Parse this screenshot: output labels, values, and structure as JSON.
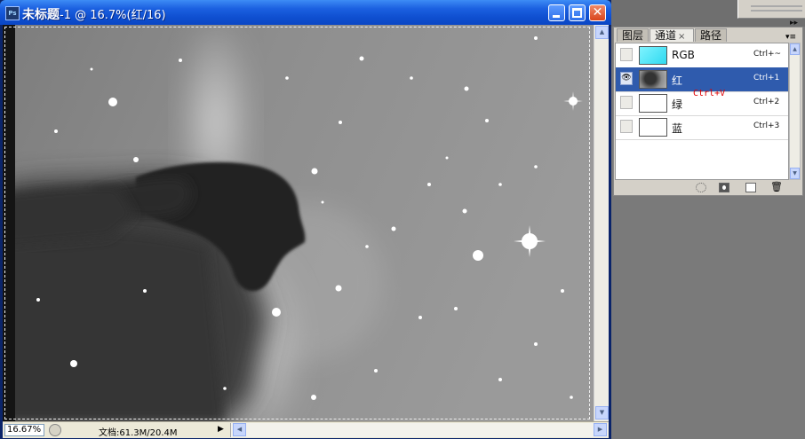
{
  "document": {
    "name": "未标题",
    "title_rest": "-1 @ 16.7%(红/16)",
    "app_icon": "Ps",
    "zoom": "16.67%",
    "doc_info": "文档:61.3M/20.4M"
  },
  "icons": {
    "minimize": "minimize-icon",
    "maximize": "maximize-icon",
    "close": "close-icon",
    "visibility": "eye-icon",
    "trash": "trash-icon"
  },
  "glyphs": {
    "close": "✕",
    "eye": "👁",
    "up": "▲",
    "down": "▼",
    "left": "◀",
    "right": "▶",
    "menu": "▾≡",
    "collapse": "▸▸",
    "trash": "🗑",
    "tab_close": "×"
  },
  "panel": {
    "tabs": [
      "图层",
      "通道",
      "路径"
    ],
    "channels": [
      {
        "name": "RGB",
        "shortcut": "Ctrl+~",
        "visible": false,
        "selected": false,
        "thumb": "cyan"
      },
      {
        "name": "红",
        "shortcut": "Ctrl+1",
        "visible": true,
        "selected": true,
        "thumb": "nebula"
      },
      {
        "name": "绿",
        "shortcut": "Ctrl+2",
        "visible": false,
        "selected": false,
        "thumb": "white"
      },
      {
        "name": "蓝",
        "shortcut": "Ctrl+3",
        "visible": false,
        "selected": false,
        "thumb": "white"
      }
    ]
  },
  "annotation": "Ctrl+V",
  "colors": {
    "title_bar": "#1b60e0",
    "selection": "#2f5bad",
    "annotation": "#e00000"
  }
}
